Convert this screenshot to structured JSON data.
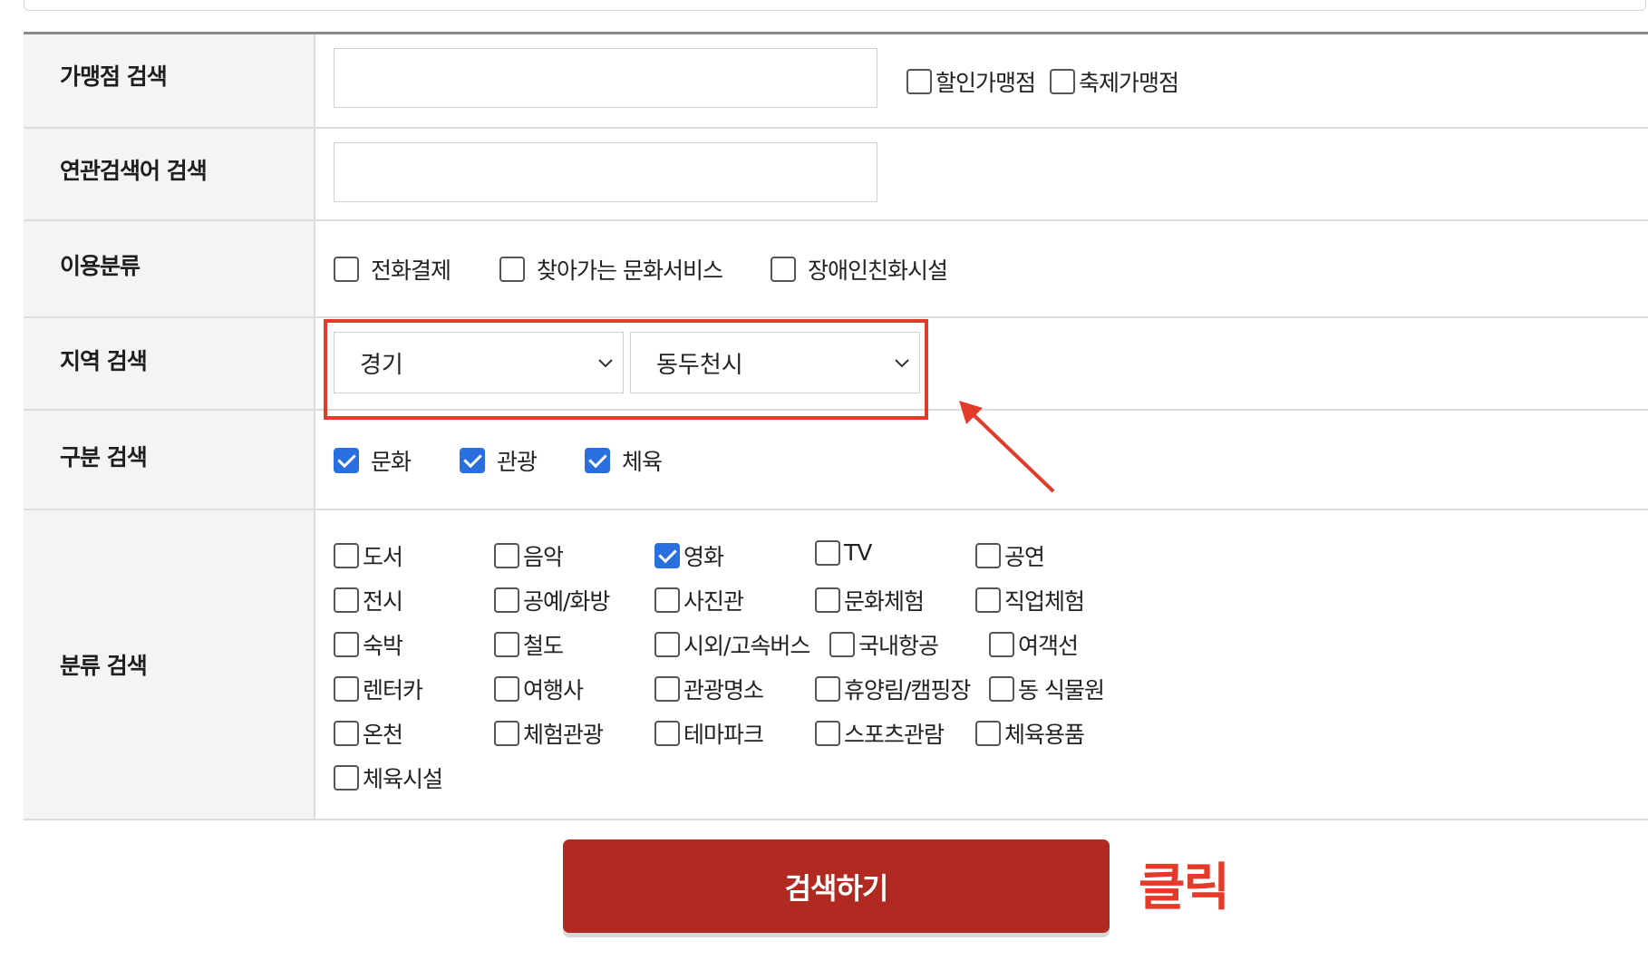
{
  "form": {
    "store_search": {
      "label": "가맹점 검색",
      "input_value": "",
      "options": [
        {
          "label": "할인가맹점",
          "checked": false
        },
        {
          "label": "축제가맹점",
          "checked": false
        }
      ]
    },
    "related_search": {
      "label": "연관검색어 검색",
      "input_value": ""
    },
    "usage_category": {
      "label": "이용분류",
      "options": [
        {
          "label": "전화결제",
          "checked": false
        },
        {
          "label": "찾아가는 문화서비스",
          "checked": false
        },
        {
          "label": "장애인친화시설",
          "checked": false
        }
      ]
    },
    "region_search": {
      "label": "지역 검색",
      "province": "경기",
      "city": "동두천시"
    },
    "type_search": {
      "label": "구분 검색",
      "options": [
        {
          "label": "문화",
          "checked": true
        },
        {
          "label": "관광",
          "checked": true
        },
        {
          "label": "체육",
          "checked": true
        }
      ]
    },
    "category_search": {
      "label": "분류 검색",
      "options": [
        {
          "label": "도서",
          "checked": false
        },
        {
          "label": "음악",
          "checked": false
        },
        {
          "label": "영화",
          "checked": true
        },
        {
          "label": "TV",
          "checked": false
        },
        {
          "label": "공연",
          "checked": false
        },
        {
          "label": "전시",
          "checked": false
        },
        {
          "label": "공예/화방",
          "checked": false
        },
        {
          "label": "사진관",
          "checked": false
        },
        {
          "label": "문화체험",
          "checked": false
        },
        {
          "label": "직업체험",
          "checked": false
        },
        {
          "label": "숙박",
          "checked": false
        },
        {
          "label": "철도",
          "checked": false
        },
        {
          "label": "시외/고속버스",
          "checked": false
        },
        {
          "label": "국내항공",
          "checked": false
        },
        {
          "label": "여객선",
          "checked": false
        },
        {
          "label": "렌터카",
          "checked": false
        },
        {
          "label": "여행사",
          "checked": false
        },
        {
          "label": "관광명소",
          "checked": false
        },
        {
          "label": "휴양림/캠핑장",
          "checked": false
        },
        {
          "label": "동 식물원",
          "checked": false
        },
        {
          "label": "온천",
          "checked": false
        },
        {
          "label": "체험관광",
          "checked": false
        },
        {
          "label": "테마파크",
          "checked": false
        },
        {
          "label": "스포츠관람",
          "checked": false
        },
        {
          "label": "체육용품",
          "checked": false
        },
        {
          "label": "체육시설",
          "checked": false
        }
      ]
    }
  },
  "search_button_label": "검색하기",
  "annotation": {
    "click_text": "클릭",
    "color": "#e23b2a"
  },
  "colors": {
    "button": "#b12a22",
    "checkbox_checked": "#2a6fe0",
    "header_bg": "#f4f4f4"
  }
}
